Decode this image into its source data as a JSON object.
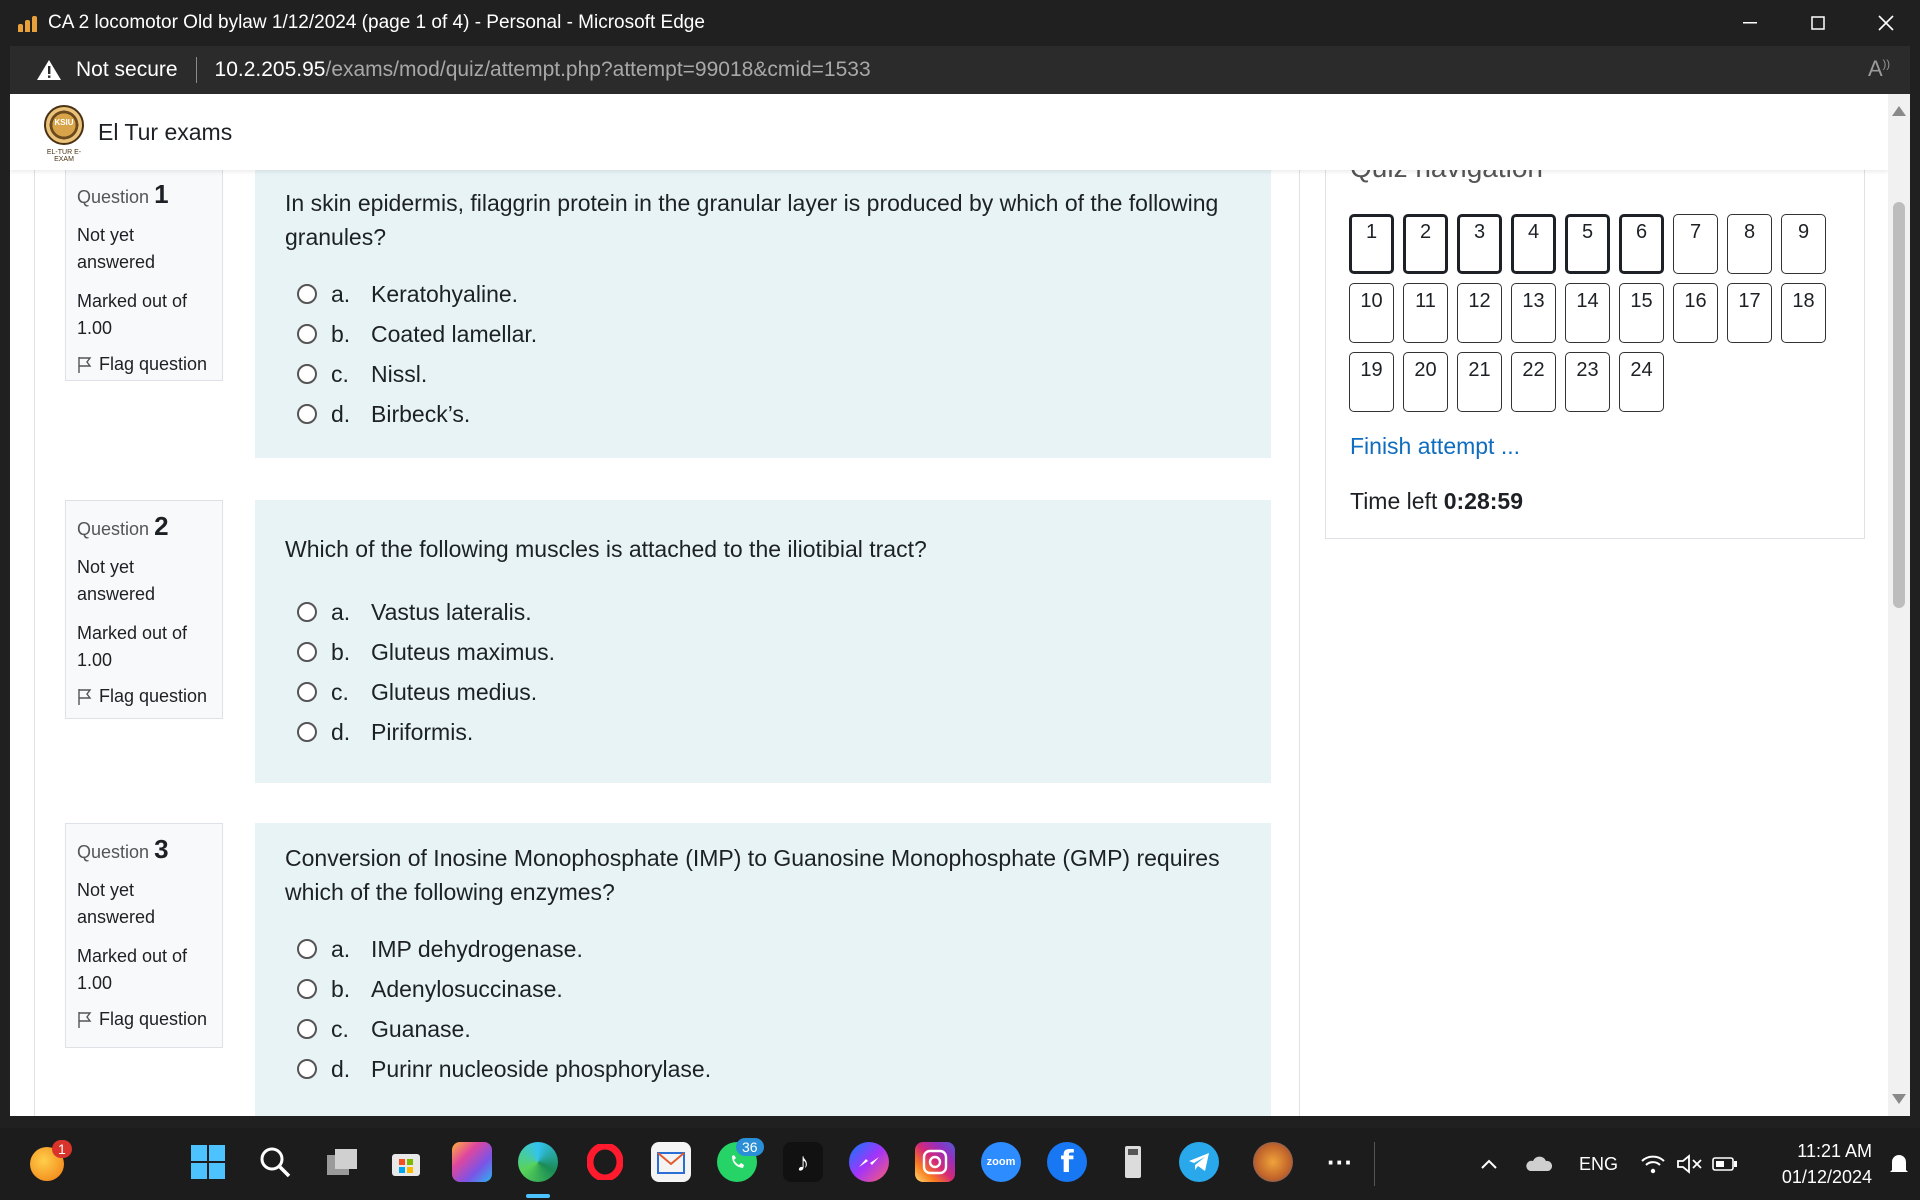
{
  "window": {
    "title": "CA 2 locomotor Old bylaw 1/12/2024 (page 1 of 4) - Personal - Microsoft Edge"
  },
  "address": {
    "security": "Not secure",
    "host": "10.2.205.95",
    "path": "/exams/mod/quiz/attempt.php?attempt=99018&cmid=1533"
  },
  "site": {
    "name": "El Tur exams",
    "logo_text": "KSIU",
    "logo_tagline": "EL-TUR E-EXAM"
  },
  "questions": [
    {
      "label": "Question",
      "number": "1",
      "status": "Not yet answered",
      "marks": "Marked out of 1.00",
      "flag": "Flag question",
      "text": "In skin epidermis, filaggrin protein in the granular layer is produced by which of the following granules?",
      "answers": [
        {
          "letter": "a.",
          "text": "Keratohyaline."
        },
        {
          "letter": "b.",
          "text": "Coated lamellar."
        },
        {
          "letter": "c.",
          "text": "Nissl."
        },
        {
          "letter": "d.",
          "text": "Birbeck’s."
        }
      ]
    },
    {
      "label": "Question",
      "number": "2",
      "status": "Not yet answered",
      "marks": "Marked out of 1.00",
      "flag": "Flag question",
      "text": "Which of the following muscles is attached to the iliotibial tract?",
      "answers": [
        {
          "letter": "a.",
          "text": "Vastus lateralis."
        },
        {
          "letter": "b.",
          "text": "Gluteus maximus."
        },
        {
          "letter": "c.",
          "text": "Gluteus medius."
        },
        {
          "letter": "d.",
          "text": "Piriformis."
        }
      ]
    },
    {
      "label": "Question",
      "number": "3",
      "status": "Not yet answered",
      "marks": "Marked out of 1.00",
      "flag": "Flag question",
      "text": "Conversion of Inosine Monophosphate (IMP) to Guanosine Monophosphate (GMP) requires which of the following enzymes?",
      "answers": [
        {
          "letter": "a.",
          "text": "IMP dehydrogenase."
        },
        {
          "letter": "b.",
          "text": "Adenylosuccinase."
        },
        {
          "letter": "c.",
          "text": "Guanase."
        },
        {
          "letter": "d.",
          "text": "Purinr nucleoside phosphorylase."
        }
      ]
    }
  ],
  "quiz_nav": {
    "title": "Quiz navigation",
    "buttons": [
      "1",
      "2",
      "3",
      "4",
      "5",
      "6",
      "7",
      "8",
      "9",
      "10",
      "11",
      "12",
      "13",
      "14",
      "15",
      "16",
      "17",
      "18",
      "19",
      "20",
      "21",
      "22",
      "23",
      "24"
    ],
    "finish": "Finish attempt ...",
    "time_label": "Time left",
    "time_value": "0:28:59"
  },
  "taskbar": {
    "notification_count": "1",
    "whatsapp_count": "36",
    "zoom_label": "zoom",
    "language": "ENG",
    "time": "11:21 AM",
    "date": "01/12/2024",
    "more": "···"
  }
}
